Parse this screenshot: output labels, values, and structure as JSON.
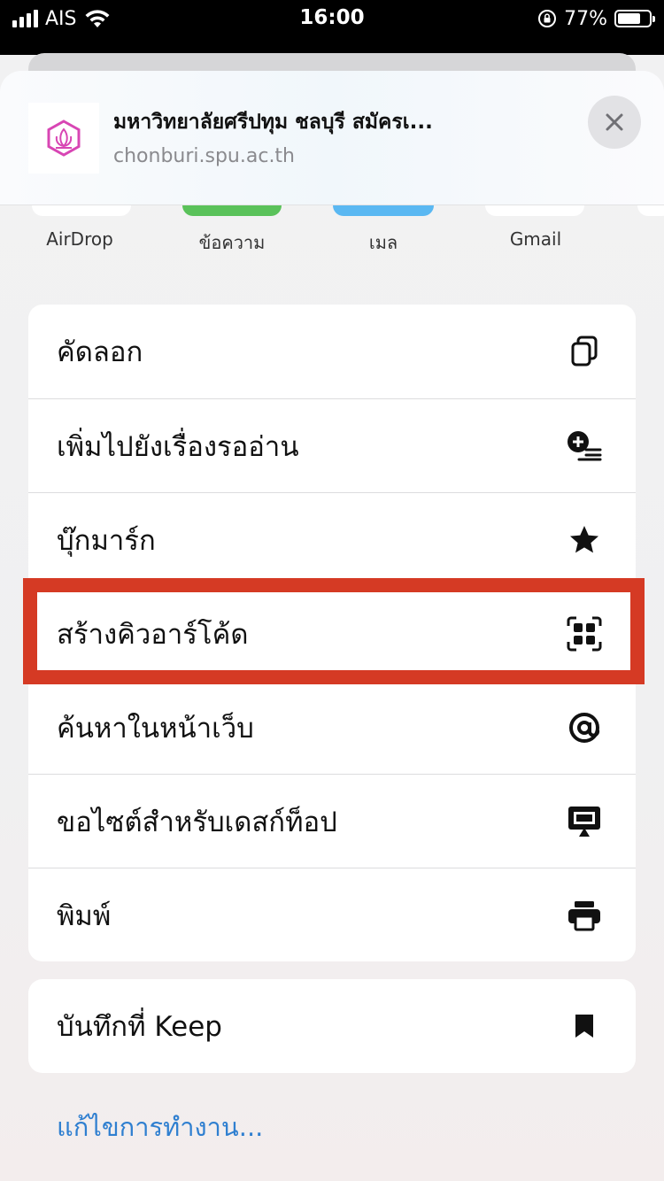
{
  "status_bar": {
    "carrier": "AIS",
    "time": "16:00",
    "battery_percent": "77%",
    "battery_level": 0.77
  },
  "share_sheet": {
    "site_title": "มหาวิทยาลัยศรีปทุม ชลบุรี สมัครเ...",
    "site_url": "chonburi.spu.ac.th",
    "apps": [
      {
        "label": "AirDrop",
        "color": "#ffffff"
      },
      {
        "label": "ข้อความ",
        "color": "#5ac25a"
      },
      {
        "label": "เมล",
        "color": "#5ab8f2"
      },
      {
        "label": "Gmail",
        "color": "#ffffff"
      }
    ],
    "actions": [
      {
        "label": "คัดลอก",
        "icon": "copy-icon"
      },
      {
        "label": "เพิ่มไปยังเรื่องรออ่าน",
        "icon": "add-reading-list-icon"
      },
      {
        "label": "บุ๊กมาร์ก",
        "icon": "star-icon"
      },
      {
        "label": "สร้างคิวอาร์โค้ด",
        "icon": "qr-code-icon"
      },
      {
        "label": "ค้นหาในหน้าเว็บ",
        "icon": "at-sign-icon"
      },
      {
        "label": "ขอไซต์สำหรับเดสก์ท็อป",
        "icon": "desktop-icon"
      },
      {
        "label": "พิมพ์",
        "icon": "printer-icon"
      }
    ],
    "secondary_actions": [
      {
        "label": "บันทึกที่ Keep",
        "icon": "bookmark-icon"
      }
    ],
    "edit_actions": "แก้ไขการทำงาน...",
    "highlight_color": "#d53a24"
  }
}
